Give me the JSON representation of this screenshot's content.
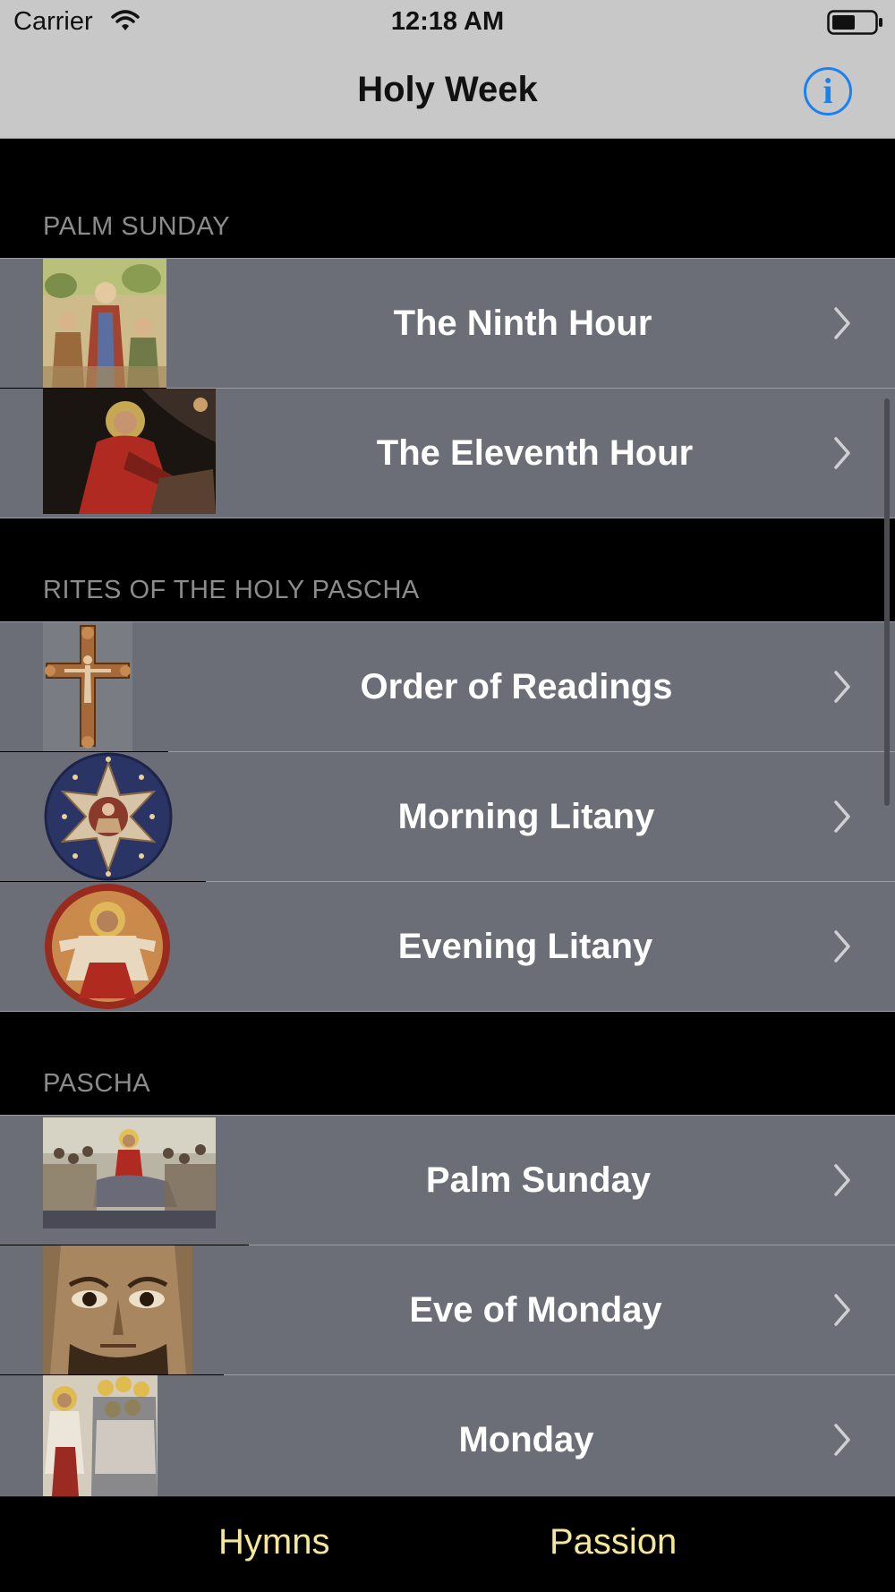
{
  "status_bar": {
    "carrier": "Carrier",
    "time": "12:18 AM",
    "wifi_icon": "wifi-icon",
    "battery_icon": "battery-icon"
  },
  "nav": {
    "title": "Holy Week",
    "info_icon": "info-icon",
    "info_glyph": "i",
    "accent_color": "#1a82f0"
  },
  "sections": [
    {
      "header": "PALM SUNDAY",
      "rows": [
        {
          "label": "The Ninth Hour",
          "thumb": "icon-christ-crowd"
        },
        {
          "label": "The Eleventh Hour",
          "thumb": "icon-christ-praying"
        }
      ]
    },
    {
      "header": "RITES OF THE HOLY PASCHA",
      "rows": [
        {
          "label": "Order of Readings",
          "thumb": "icon-coptic-cross"
        },
        {
          "label": "Morning Litany",
          "thumb": "icon-star-medallion"
        },
        {
          "label": "Evening Litany",
          "thumb": "icon-christ-medallion"
        }
      ]
    },
    {
      "header": "PASCHA",
      "rows": [
        {
          "label": "Palm Sunday",
          "thumb": "icon-entry-jerusalem"
        },
        {
          "label": "Eve of Monday",
          "thumb": "icon-christ-face"
        },
        {
          "label": "Monday",
          "thumb": "icon-apostles"
        }
      ]
    }
  ],
  "tabs": [
    {
      "label": "Hymns"
    },
    {
      "label": "Passion"
    }
  ],
  "colors": {
    "row_background": "#6c6e77",
    "section_header_text": "#8c8c8c",
    "tab_text": "#f4e79a",
    "bars": "#c8c8c8"
  }
}
